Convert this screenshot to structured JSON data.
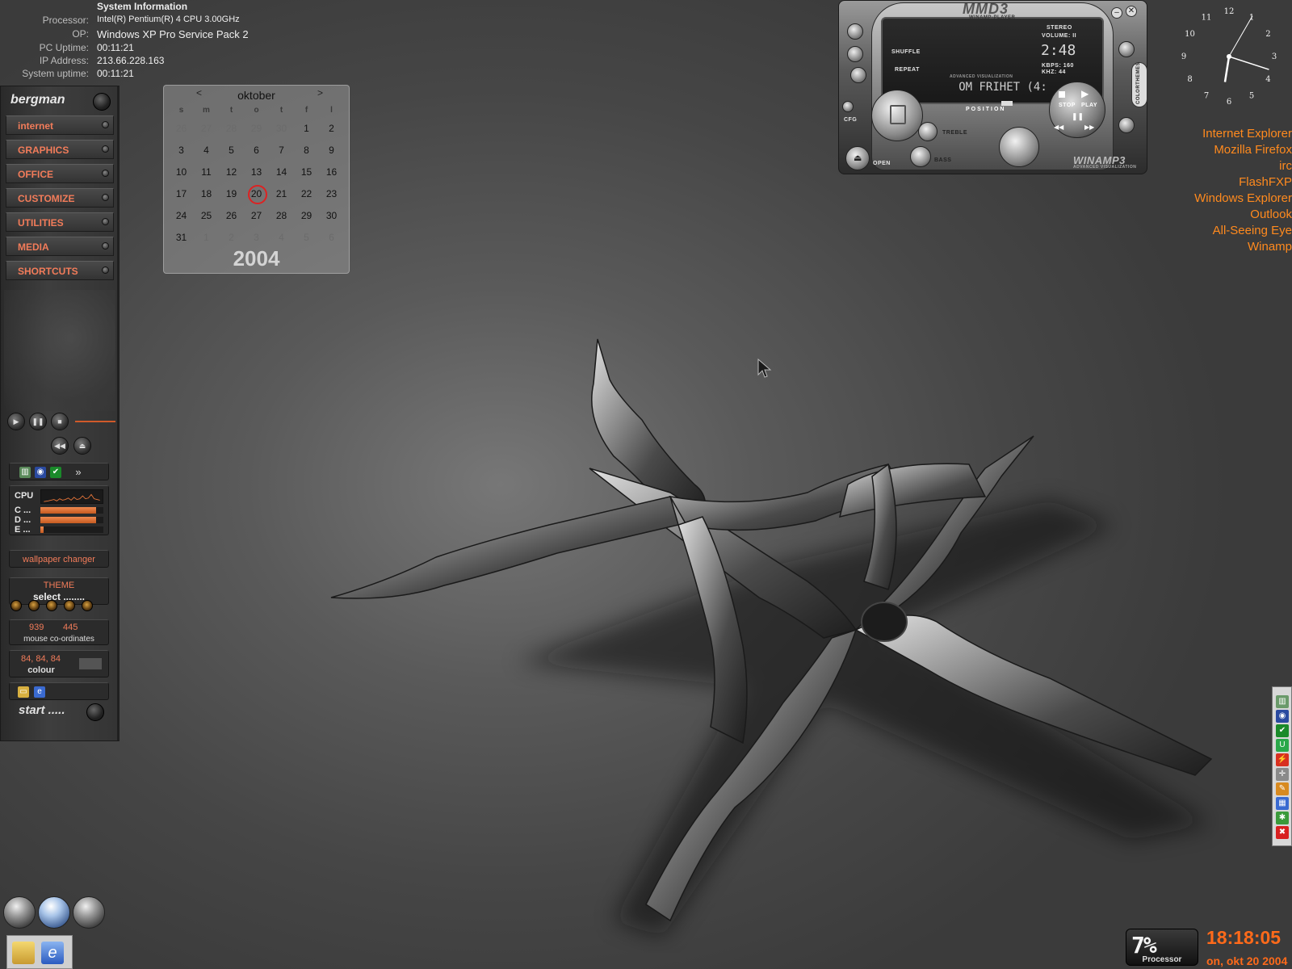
{
  "system_info": {
    "title": "System Information",
    "rows": [
      {
        "label": "Processor:",
        "value": "Intel(R) Pentium(R) 4 CPU 3.00GHz"
      },
      {
        "label": "OP:",
        "value": "Windows XP Pro Service Pack 2"
      },
      {
        "label": "PC Uptime:",
        "value": "00:11:21"
      },
      {
        "label": "IP Address:",
        "value": "213.66.228.163"
      },
      {
        "label": "System uptime:",
        "value": "00:11:21"
      }
    ]
  },
  "sidebar": {
    "user": "bergman",
    "categories": [
      "internet",
      "GRAPHICS",
      "OFFICE",
      "CUSTOMIZE",
      "UTILITIES",
      "MEDIA",
      "SHORTCUTS"
    ],
    "tray_more": "»",
    "cpu": {
      "label": "CPU",
      "drives": [
        {
          "label": "C ...",
          "fill": 0.88
        },
        {
          "label": "D ...",
          "fill": 0.88
        },
        {
          "label": "E ...",
          "fill": 0.05
        }
      ],
      "accent": "#e8763a"
    },
    "wallpaper_changer": "wallpaper changer",
    "theme": {
      "title": "THEME",
      "value": "select ........"
    },
    "mouse": {
      "x": "939",
      "y": "445",
      "label": "mouse co-ordinates"
    },
    "colour": {
      "value": "84, 84, 84",
      "label": "colour"
    },
    "start": "start .....",
    "accent_color": "#f27c5a"
  },
  "calendar": {
    "month": "oktober",
    "prev": "<",
    "next": ">",
    "year": "2004",
    "weekdays": [
      "s",
      "m",
      "t",
      "o",
      "t",
      "f",
      "l"
    ],
    "weeks": [
      [
        "26",
        "27",
        "28",
        "29",
        "30",
        "1",
        "2"
      ],
      [
        "3",
        "4",
        "5",
        "6",
        "7",
        "8",
        "9"
      ],
      [
        "10",
        "11",
        "12",
        "13",
        "14",
        "15",
        "16"
      ],
      [
        "17",
        "18",
        "19",
        "20",
        "21",
        "22",
        "23"
      ],
      [
        "24",
        "25",
        "26",
        "27",
        "28",
        "29",
        "30"
      ],
      [
        "31",
        "1",
        "2",
        "3",
        "4",
        "5",
        "6"
      ]
    ],
    "today": "20"
  },
  "player": {
    "logo": "MMD3",
    "sublogo": "WINAMP-PLAYER",
    "stereo": "STEREO",
    "volume": "VOLUME: II",
    "time": "2:48",
    "kbps": "KBPS: 160",
    "khz": "KHZ: 44",
    "shuffle": "SHUFFLE",
    "repeat": "REPEAT",
    "adv_vis": "ADVANCED VISUALIZATION",
    "track": "OM FRIHET (4:",
    "position": "POSITION",
    "treble": "TREBLE",
    "bass": "BASS",
    "open": "OPEN",
    "stop": "STOP",
    "play": "PLAY",
    "cfg": "CFG",
    "colorthemes": "COLORTHEMES",
    "brand": "WINAMP3",
    "brand_sub": "ADVANCED VISUALIZATION"
  },
  "clock": {
    "numerals": [
      "12",
      "1",
      "2",
      "3",
      "4",
      "5",
      "6",
      "7",
      "8",
      "9",
      "10",
      "11"
    ],
    "hour": 6,
    "minute": 18,
    "second": 5
  },
  "shortcuts": [
    "Internet Explorer",
    "Mozilla Firefox",
    "irc",
    "FlashFXP",
    "Windows Explorer",
    "Outlook",
    "All-Seeing Eye",
    "Winamp"
  ],
  "shortcut_color": "#ff8a1e",
  "processor_meter": {
    "value": "7%",
    "label": "Processor"
  },
  "taskbar_clock": {
    "time": "18:18:05",
    "date": "on, okt 20 2004"
  }
}
